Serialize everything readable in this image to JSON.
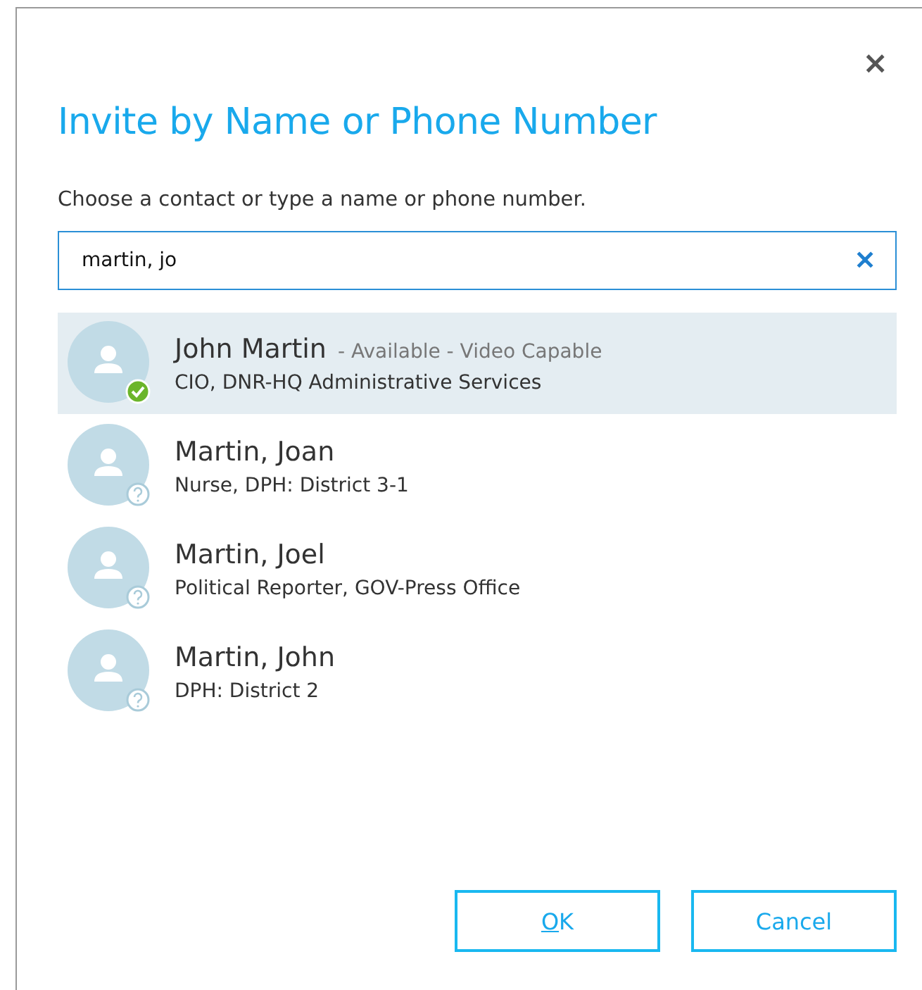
{
  "dialog": {
    "close": "×",
    "title": "Invite by Name or Phone Number",
    "prompt": "Choose a contact or type a name or phone number.",
    "search": {
      "value": "martin, jo",
      "clear": "✕"
    },
    "contacts": [
      {
        "name": "John Martin",
        "status_text": "- Available - Video Capable",
        "detail": "CIO, DNR-HQ Administrative Services",
        "available": true,
        "selected": true
      },
      {
        "name": "Martin, Joan",
        "detail": "Nurse, DPH: District 3-1",
        "available": false,
        "selected": false
      },
      {
        "name": "Martin, Joel",
        "detail": "Political Reporter, GOV-Press Office",
        "available": false,
        "selected": false
      },
      {
        "name": "Martin, John",
        "detail": "DPH: District 2",
        "available": false,
        "selected": false
      }
    ],
    "buttons": [
      {
        "label": "OK",
        "mnemonic": true
      },
      {
        "label": "Cancel"
      }
    ]
  }
}
